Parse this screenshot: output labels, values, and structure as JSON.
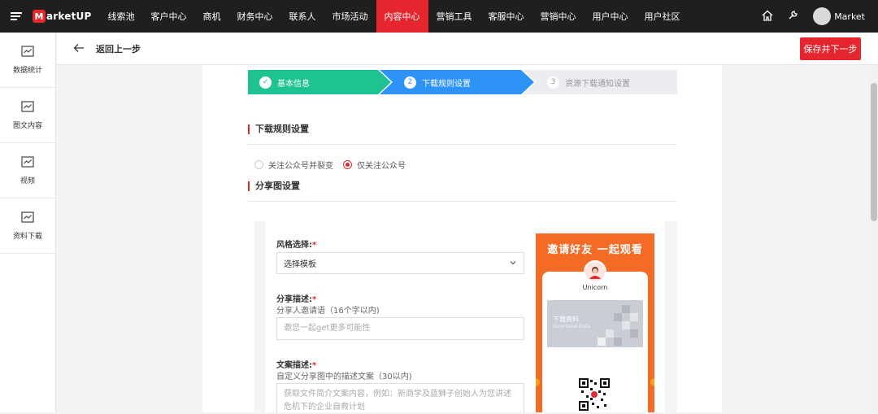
{
  "topbar": {
    "logo_letter": "M",
    "logo_text": "arketUP",
    "nav": [
      "线索池",
      "客户中心",
      "商机",
      "财务中心",
      "联系人",
      "市场活动",
      "内容中心",
      "营销工具",
      "客服中心",
      "营销中心",
      "用户中心",
      "用户社区"
    ],
    "active_index": 6,
    "user_name": "Market",
    "accent_color": "#e5262f"
  },
  "sidebar": {
    "items": [
      {
        "label": "数据统计",
        "icon": "chart-icon"
      },
      {
        "label": "图文内容",
        "icon": "chart-icon"
      },
      {
        "label": "视频",
        "icon": "chart-icon"
      },
      {
        "label": "资料下载",
        "icon": "chart-icon"
      }
    ]
  },
  "subheader": {
    "back_label": "返回上一步",
    "save_label": "保存并下一步"
  },
  "steps": [
    {
      "num": "✓",
      "label": "基本信息",
      "status": "done"
    },
    {
      "num": "2",
      "label": "下载规则设置",
      "status": "active"
    },
    {
      "num": "3",
      "label": "资源下载通知设置",
      "status": "pending"
    }
  ],
  "rules": {
    "title": "下载规则设置",
    "options": [
      {
        "label": "关注公众号并裂变",
        "checked": false
      },
      {
        "label": "仅关注公众号",
        "checked": true
      }
    ]
  },
  "share": {
    "title": "分享图设置",
    "style_label": "风格选择:",
    "style_value": "选择模板",
    "desc_label": "分享描述:",
    "desc_hint": "分享人邀请语（16个字以内)",
    "desc_placeholder": "邀您一起get更多可能性",
    "copy_label": "文案描述:",
    "copy_hint": "自定义分享图中的描述文案（30以内)",
    "copy_placeholder": "获取文件简介文案内容，例如：新商学及蓝狮子创始人为您讲述危机下的企业自救计划",
    "required_mark": "*"
  },
  "poster": {
    "title": "邀请好友 一起观看",
    "name": "Unicorn",
    "img_title": "下载资料",
    "img_subtitle": "Download Data"
  }
}
